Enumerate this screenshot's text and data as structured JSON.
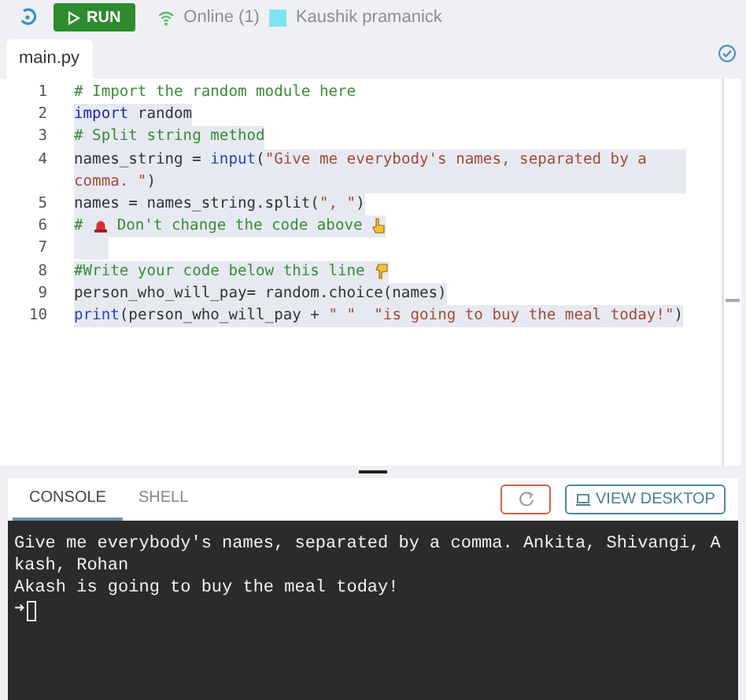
{
  "toolbar": {
    "run_label": "RUN",
    "online": "Online (1)",
    "user": {
      "name": "Kaushik pramanick",
      "color": "#7fe3f5"
    }
  },
  "editor": {
    "tabs": [
      {
        "label": "main.py",
        "selected": true
      }
    ],
    "lines": [
      {
        "number": "1",
        "highlighted": false,
        "tokens": [
          {
            "kind": "comment",
            "text": "# Import the random module here"
          }
        ]
      },
      {
        "number": "2",
        "highlighted": true,
        "tokens": [
          {
            "kind": "keyword",
            "text": "import"
          },
          {
            "kind": "plain",
            "text": " random"
          }
        ]
      },
      {
        "number": "3",
        "highlighted": true,
        "tokens": [
          {
            "kind": "comment",
            "text": "# Split string method"
          }
        ]
      },
      {
        "number": "4",
        "highlighted": true,
        "tokens": [
          {
            "kind": "plain",
            "text": "names_string = "
          },
          {
            "kind": "builtin",
            "text": "input"
          },
          {
            "kind": "plain",
            "text": "("
          },
          {
            "kind": "string",
            "text": "\"Give me everybody's names, separated by a comma. \""
          },
          {
            "kind": "plain",
            "text": ")"
          }
        ]
      },
      {
        "number": "5",
        "highlighted": true,
        "tokens": [
          {
            "kind": "plain",
            "text": "names = names_string.split("
          },
          {
            "kind": "string",
            "text": "\", \""
          },
          {
            "kind": "plain",
            "text": ")"
          }
        ]
      },
      {
        "number": "6",
        "highlighted": true,
        "tokens": [
          {
            "kind": "comment",
            "text": "# "
          },
          {
            "kind": "siren"
          },
          {
            "kind": "comment",
            "text": " Don't change the code above "
          },
          {
            "kind": "hand-up"
          }
        ]
      },
      {
        "number": "7",
        "highlighted": true
      },
      {
        "number": "8",
        "highlighted": true,
        "tokens": [
          {
            "kind": "comment",
            "text": "#Write your code below this line "
          },
          {
            "kind": "hand-down"
          }
        ]
      },
      {
        "number": "9",
        "highlighted": true,
        "tokens": [
          {
            "kind": "plain",
            "text": "person_who_will_pay= random.choice(names)"
          }
        ]
      },
      {
        "number": "10",
        "highlighted": true,
        "tokens": [
          {
            "kind": "builtin",
            "text": "print"
          },
          {
            "kind": "plain",
            "text": "(person_who_will_pay + "
          },
          {
            "kind": "string",
            "text": "\" \"  "
          },
          {
            "kind": "string",
            "text": "\"is going to buy the meal today!\""
          },
          {
            "kind": "plain",
            "text": ")"
          }
        ]
      }
    ]
  },
  "console": {
    "tabs": [
      {
        "label": "CONSOLE",
        "selected": true
      },
      {
        "label": "SHELL",
        "selected": false
      }
    ],
    "view_desktop": "VIEW DESKTOP",
    "output": [
      "Give me everybody's names, separated by a comma. Ankita, Shivangi, Akash, Rohan",
      "Akash is going to buy the meal today!"
    ],
    "prompt": "➜"
  }
}
